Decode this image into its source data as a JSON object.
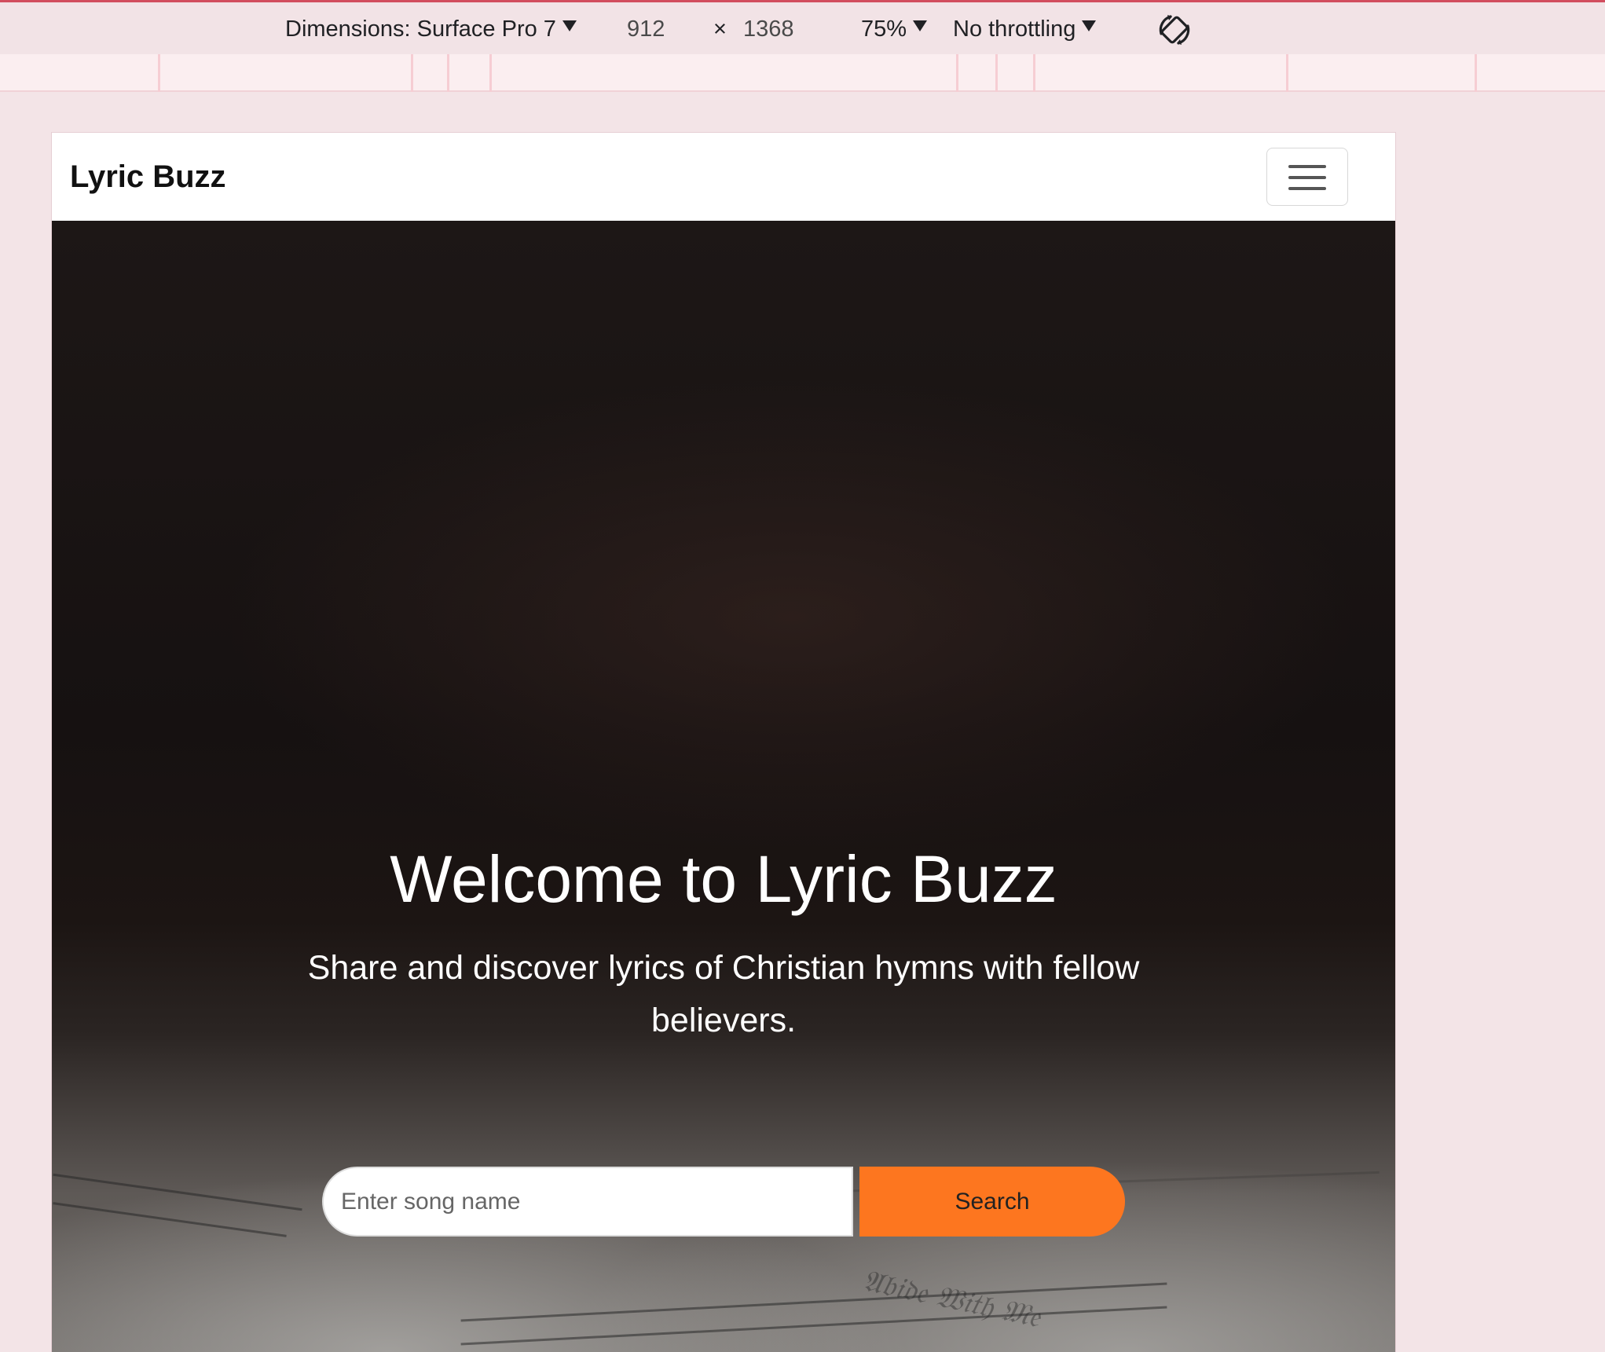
{
  "devtools": {
    "dimensions_label": "Dimensions: Surface Pro 7",
    "width": "912",
    "times": "×",
    "height": "1368",
    "zoom": "75%",
    "throttling": "No throttling",
    "rotate_icon": "rotate-icon"
  },
  "site": {
    "brand": "Lyric Buzz",
    "menu_icon": "hamburger-icon",
    "hero": {
      "title": "Welcome to Lyric Buzz",
      "subtitle": "Share and discover lyrics of Christian hymns with fellow believers.",
      "search_placeholder": "Enter song name",
      "search_button": "Search"
    }
  },
  "colors": {
    "accent": "#fd761f",
    "devtools_accent": "#d24d5e"
  }
}
